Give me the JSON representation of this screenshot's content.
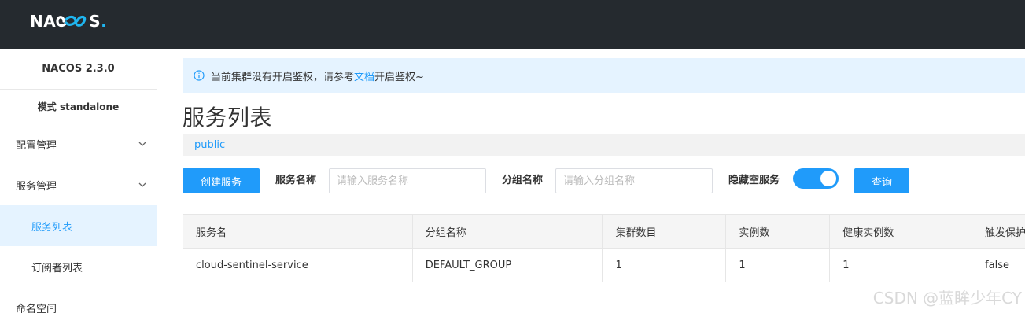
{
  "header": {
    "logo_left": "NA",
    "logo_right": "S",
    "logo_dot": "."
  },
  "sidebar": {
    "version": "NACOS 2.3.0",
    "mode": "模式 standalone",
    "items": [
      {
        "label": "配置管理"
      },
      {
        "label": "服务管理"
      },
      {
        "label": "服务列表"
      },
      {
        "label": "订阅者列表"
      },
      {
        "label": "命名空间"
      }
    ]
  },
  "notice": {
    "before": "当前集群没有开启鉴权，请参考",
    "link": "文档",
    "after": "开启鉴权~"
  },
  "page": {
    "title": "服务列表",
    "namespace": "public"
  },
  "toolbar": {
    "create_label": "创建服务",
    "service_name_label": "服务名称",
    "service_name_placeholder": "请输入服务名称",
    "group_name_label": "分组名称",
    "group_name_placeholder": "请输入分组名称",
    "hide_empty_label": "隐藏空服务",
    "hide_empty_on": true,
    "query_label": "查询"
  },
  "table": {
    "headers": [
      "服务名",
      "分组名称",
      "集群数目",
      "实例数",
      "健康实例数",
      "触发保护"
    ],
    "rows": [
      [
        "cloud-sentinel-service",
        "DEFAULT_GROUP",
        "1",
        "1",
        "1",
        "false"
      ]
    ]
  },
  "watermark": "CSDN @蓝眸少年CY",
  "colors": {
    "header_bg": "#252a2f",
    "accent": "#209bfa",
    "active_bg": "#e5f3ff"
  }
}
